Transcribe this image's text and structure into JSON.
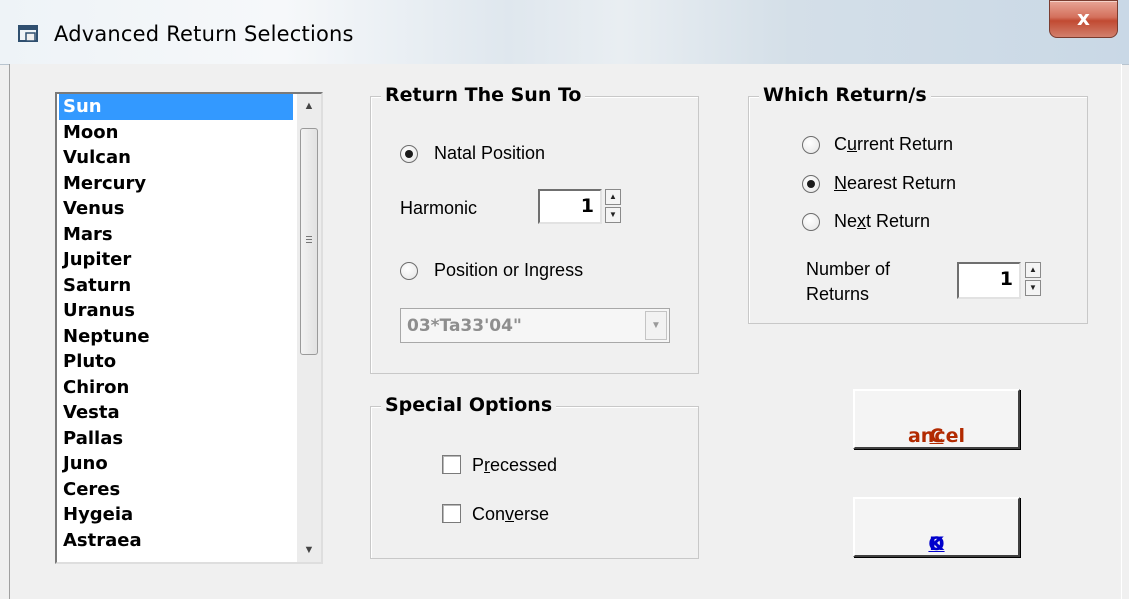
{
  "window": {
    "title": "Advanced Return Selections",
    "close_label": "x"
  },
  "planets": {
    "items": [
      "Sun",
      "Moon",
      "Vulcan",
      "Mercury",
      "Venus",
      "Mars",
      "Jupiter",
      "Saturn",
      "Uranus",
      "Neptune",
      "Pluto",
      "Chiron",
      "Vesta",
      "Pallas",
      "Juno",
      "Ceres",
      "Hygeia",
      "Astraea"
    ],
    "selected": "Sun"
  },
  "return_to": {
    "title": "Return The Sun To",
    "natal_label": "Natal Position",
    "harmonic_label": "Harmonic",
    "harmonic_value": "1",
    "position_label": "Position or Ingress",
    "position_value": "03*Ta33'04\"",
    "selected": "Natal Position"
  },
  "which_returns": {
    "title": "Which Return/s",
    "current": {
      "pre": "C",
      "accel": "u",
      "post": "rrent Return"
    },
    "nearest": {
      "pre": "",
      "accel": "N",
      "post": "earest Return"
    },
    "next": {
      "pre": "Ne",
      "accel": "x",
      "post": "t Return"
    },
    "selected": "Nearest Return",
    "number_label_line1": "Number of",
    "number_label_line2": "Returns",
    "number_value": "1"
  },
  "special_options": {
    "title": "Special Options",
    "precessed": {
      "pre": "P",
      "accel": "r",
      "post": "ecessed",
      "checked": false
    },
    "converse": {
      "pre": "Con",
      "accel": "v",
      "post": "erse",
      "checked": false
    }
  },
  "buttons": {
    "cancel": {
      "accel": "C",
      "post": "ancel",
      "color": "#b22a00"
    },
    "ok": {
      "accel": "O",
      "post": "K",
      "color": "#0000cc"
    }
  },
  "colors": {
    "selection": "#3399ff",
    "close": "#c14a32"
  }
}
